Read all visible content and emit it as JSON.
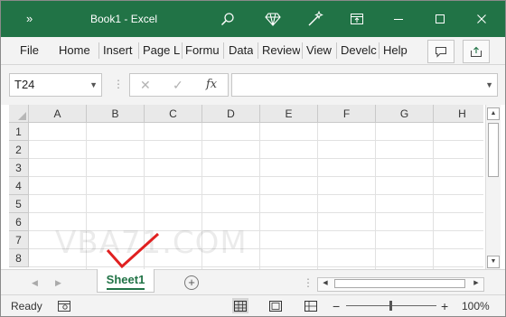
{
  "titlebar": {
    "title": "Book1  -  Excel",
    "overflow_glyph": "»",
    "icons": [
      "search-icon",
      "diamond-icon",
      "wand-icon",
      "ribbon-display-icon",
      "minimize-icon",
      "maximize-icon",
      "close-icon"
    ],
    "bg_color": "#217346"
  },
  "ribbon": {
    "tabs": [
      "File",
      "Home",
      "Insert",
      "Page L",
      "Formu",
      "Data",
      "Review",
      "View",
      "Develc",
      "Help"
    ],
    "icons": [
      "comments-icon",
      "share-icon"
    ]
  },
  "formula_bar": {
    "name_box": "T24",
    "fx_label": "fx",
    "formula": ""
  },
  "grid": {
    "columns": [
      "A",
      "B",
      "C",
      "D",
      "E",
      "F",
      "G",
      "H"
    ],
    "rows": [
      "1",
      "2",
      "3",
      "4",
      "5",
      "6",
      "7",
      "8"
    ]
  },
  "sheets": {
    "tabs": [
      "Sheet1"
    ],
    "add_glyph": "+"
  },
  "watermark": "VBA71.COM",
  "statusbar": {
    "status": "Ready",
    "zoom_minus": "−",
    "zoom_plus": "+",
    "zoom": "100%"
  }
}
